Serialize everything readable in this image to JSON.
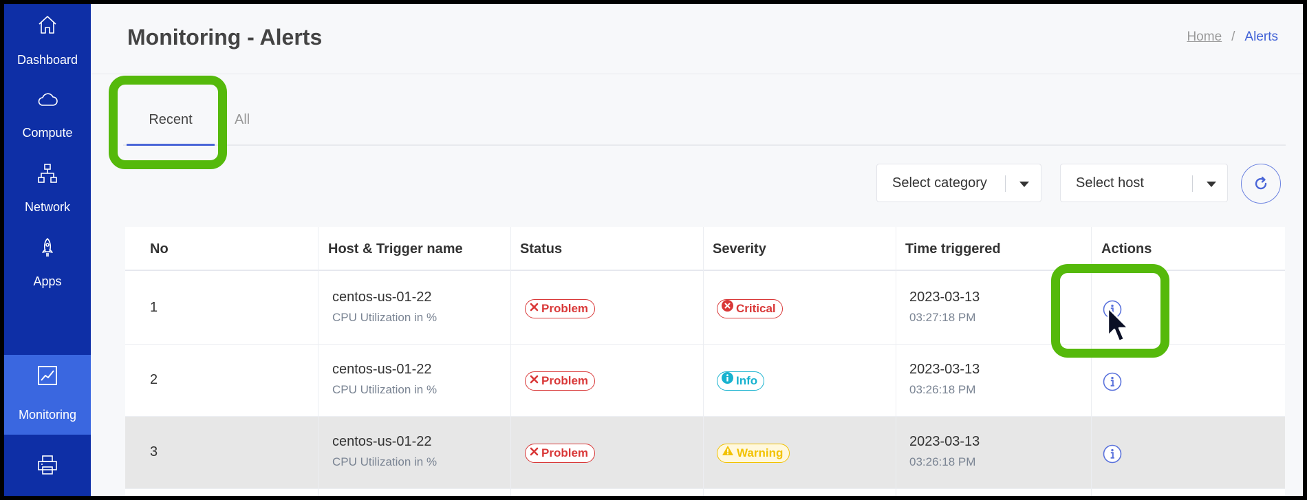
{
  "sidebar": {
    "items": [
      {
        "label": "Dashboard",
        "icon": "home-icon",
        "active": false
      },
      {
        "label": "Compute",
        "icon": "cloud-icon",
        "active": false
      },
      {
        "label": "Network",
        "icon": "network-icon",
        "active": false
      },
      {
        "label": "Apps",
        "icon": "rocket-icon",
        "active": false
      },
      {
        "label": "Monitoring",
        "icon": "chart-line-icon",
        "active": true
      },
      {
        "label": "",
        "icon": "printer-icon",
        "active": false
      }
    ]
  },
  "header": {
    "title": "Monitoring - Alerts",
    "breadcrumb": {
      "home": "Home",
      "separator": "/",
      "current": "Alerts"
    }
  },
  "tabs": [
    {
      "label": "Recent",
      "active": true
    },
    {
      "label": "All",
      "active": false
    }
  ],
  "filters": {
    "category_placeholder": "Select category",
    "host_placeholder": "Select host"
  },
  "table": {
    "columns": [
      "No",
      "Host & Trigger name",
      "Status",
      "Severity",
      "Time triggered",
      "Actions"
    ],
    "rows": [
      {
        "no": "1",
        "host": "centos-us-01-22",
        "trigger": "CPU Utilization in %",
        "status": "Problem",
        "severity": "Critical",
        "date": "2023-03-13",
        "time": "03:27:18 PM"
      },
      {
        "no": "2",
        "host": "centos-us-01-22",
        "trigger": "CPU Utilization in %",
        "status": "Problem",
        "severity": "Info",
        "date": "2023-03-13",
        "time": "03:26:18 PM"
      },
      {
        "no": "3",
        "host": "centos-us-01-22",
        "trigger": "CPU Utilization in %",
        "status": "Problem",
        "severity": "Warning",
        "date": "2023-03-13",
        "time": "03:26:18 PM"
      }
    ]
  },
  "colors": {
    "sidebar_bg": "#0e2fa6",
    "sidebar_active": "#3a67e0",
    "accent": "#3f60d6",
    "highlight": "#55b90b",
    "problem": "#d93838",
    "info": "#17b2cf",
    "warning": "#f2c200"
  }
}
